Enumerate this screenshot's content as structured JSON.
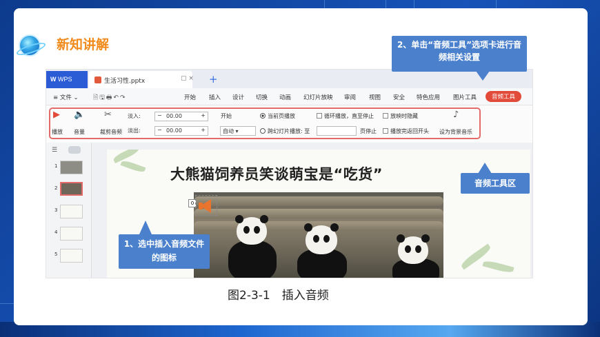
{
  "slide": {
    "section_title": "新知讲解",
    "caption": "图2-3-1　插入音频"
  },
  "callouts": {
    "audio_tools": "2、单击“音频工具”选项卡进行音频相关设置",
    "audio_tools_area": "音频工具区",
    "select_icon": "1、选中插入音频文件的图标"
  },
  "screenshot": {
    "app_tab": "WPS",
    "doc_tab": "生活习性.pptx",
    "menu": {
      "file": "≡ 文件 ⌄",
      "items": [
        "开始",
        "插入",
        "设计",
        "切换",
        "动画",
        "幻灯片放映",
        "审阅",
        "视图",
        "安全",
        "特色应用",
        "图片工具"
      ],
      "active": "音频工具"
    },
    "ribbon": {
      "play": "播放",
      "volume": "音量",
      "trim": "裁剪音频",
      "fade_in_label": "淡入:",
      "fade_in_value": "00.00",
      "fade_out_label": "淡出:",
      "fade_out_value": "00.00",
      "start_label": "开始",
      "start_value": "自动",
      "current_page": "当前页播放",
      "cross_slides": "跨幻灯片播放: 至",
      "page_stop": "页停止",
      "loop": "循环播放，直至停止",
      "hide": "放映时隐藏",
      "rewind": "播放完返回开头",
      "bg_music": "设为背景音乐"
    },
    "thumbnail_numbers": [
      "1",
      "2",
      "3",
      "4",
      "5"
    ],
    "slide_title": "大熊猫饲养员笑谈萌宝是“吃货”",
    "audio_badge": "0"
  }
}
